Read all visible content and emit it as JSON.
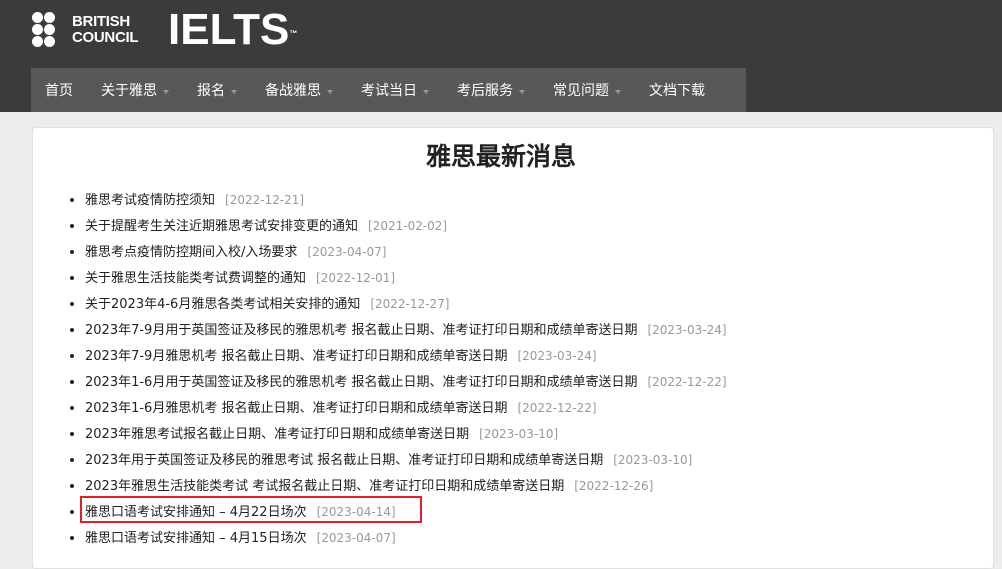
{
  "brand": {
    "logo_line1": "BRITISH",
    "logo_line2": "COUNCIL",
    "product": "IELTS",
    "trademark": "™"
  },
  "nav": {
    "items": [
      {
        "label": "首页",
        "dropdown": false
      },
      {
        "label": "关于雅思",
        "dropdown": true
      },
      {
        "label": "报名",
        "dropdown": true
      },
      {
        "label": "备战雅思",
        "dropdown": true
      },
      {
        "label": "考试当日",
        "dropdown": true
      },
      {
        "label": "考后服务",
        "dropdown": true
      },
      {
        "label": "常见问题",
        "dropdown": true
      },
      {
        "label": "文档下载",
        "dropdown": false
      }
    ]
  },
  "main": {
    "title": "雅思最新消息",
    "news": [
      {
        "title": "雅思考试疫情防控须知",
        "date": "[2022-12-21]"
      },
      {
        "title": "关于提醒考生关注近期雅思考试安排变更的通知",
        "date": "[2021-02-02]"
      },
      {
        "title": "雅思考点疫情防控期间入校/入场要求",
        "date": "[2023-04-07]"
      },
      {
        "title": "关于雅思生活技能类考试费调整的通知",
        "date": "[2022-12-01]"
      },
      {
        "title": "关于2023年4-6月雅思各类考试相关安排的通知",
        "date": "[2022-12-27]"
      },
      {
        "title": "2023年7-9月用于英国签证及移民的雅思机考 报名截止日期、准考证打印日期和成绩单寄送日期",
        "date": "[2023-03-24]"
      },
      {
        "title": "2023年7-9月雅思机考 报名截止日期、准考证打印日期和成绩单寄送日期",
        "date": "[2023-03-24]"
      },
      {
        "title": "2023年1-6月用于英国签证及移民的雅思机考 报名截止日期、准考证打印日期和成绩单寄送日期",
        "date": "[2022-12-22]"
      },
      {
        "title": "2023年1-6月雅思机考 报名截止日期、准考证打印日期和成绩单寄送日期",
        "date": "[2022-12-22]"
      },
      {
        "title": "2023年雅思考试报名截止日期、准考证打印日期和成绩单寄送日期",
        "date": "[2023-03-10]"
      },
      {
        "title": "2023年用于英国签证及移民的雅思考试 报名截止日期、准考证打印日期和成绩单寄送日期",
        "date": "[2023-03-10]"
      },
      {
        "title": "2023年雅思生活技能类考试 考试报名截止日期、准考证打印日期和成绩单寄送日期",
        "date": "[2022-12-26]"
      },
      {
        "title": "雅思口语考试安排通知 – 4月22日场次",
        "date": "[2023-04-14]"
      },
      {
        "title": "雅思口语考试安排通知 – 4月15日场次",
        "date": "[2023-04-07]"
      }
    ]
  },
  "colors": {
    "header_bg": "#3b3b3c",
    "nav_bg": "#58585a",
    "highlight": "#e0202a",
    "date_text": "#999999"
  }
}
